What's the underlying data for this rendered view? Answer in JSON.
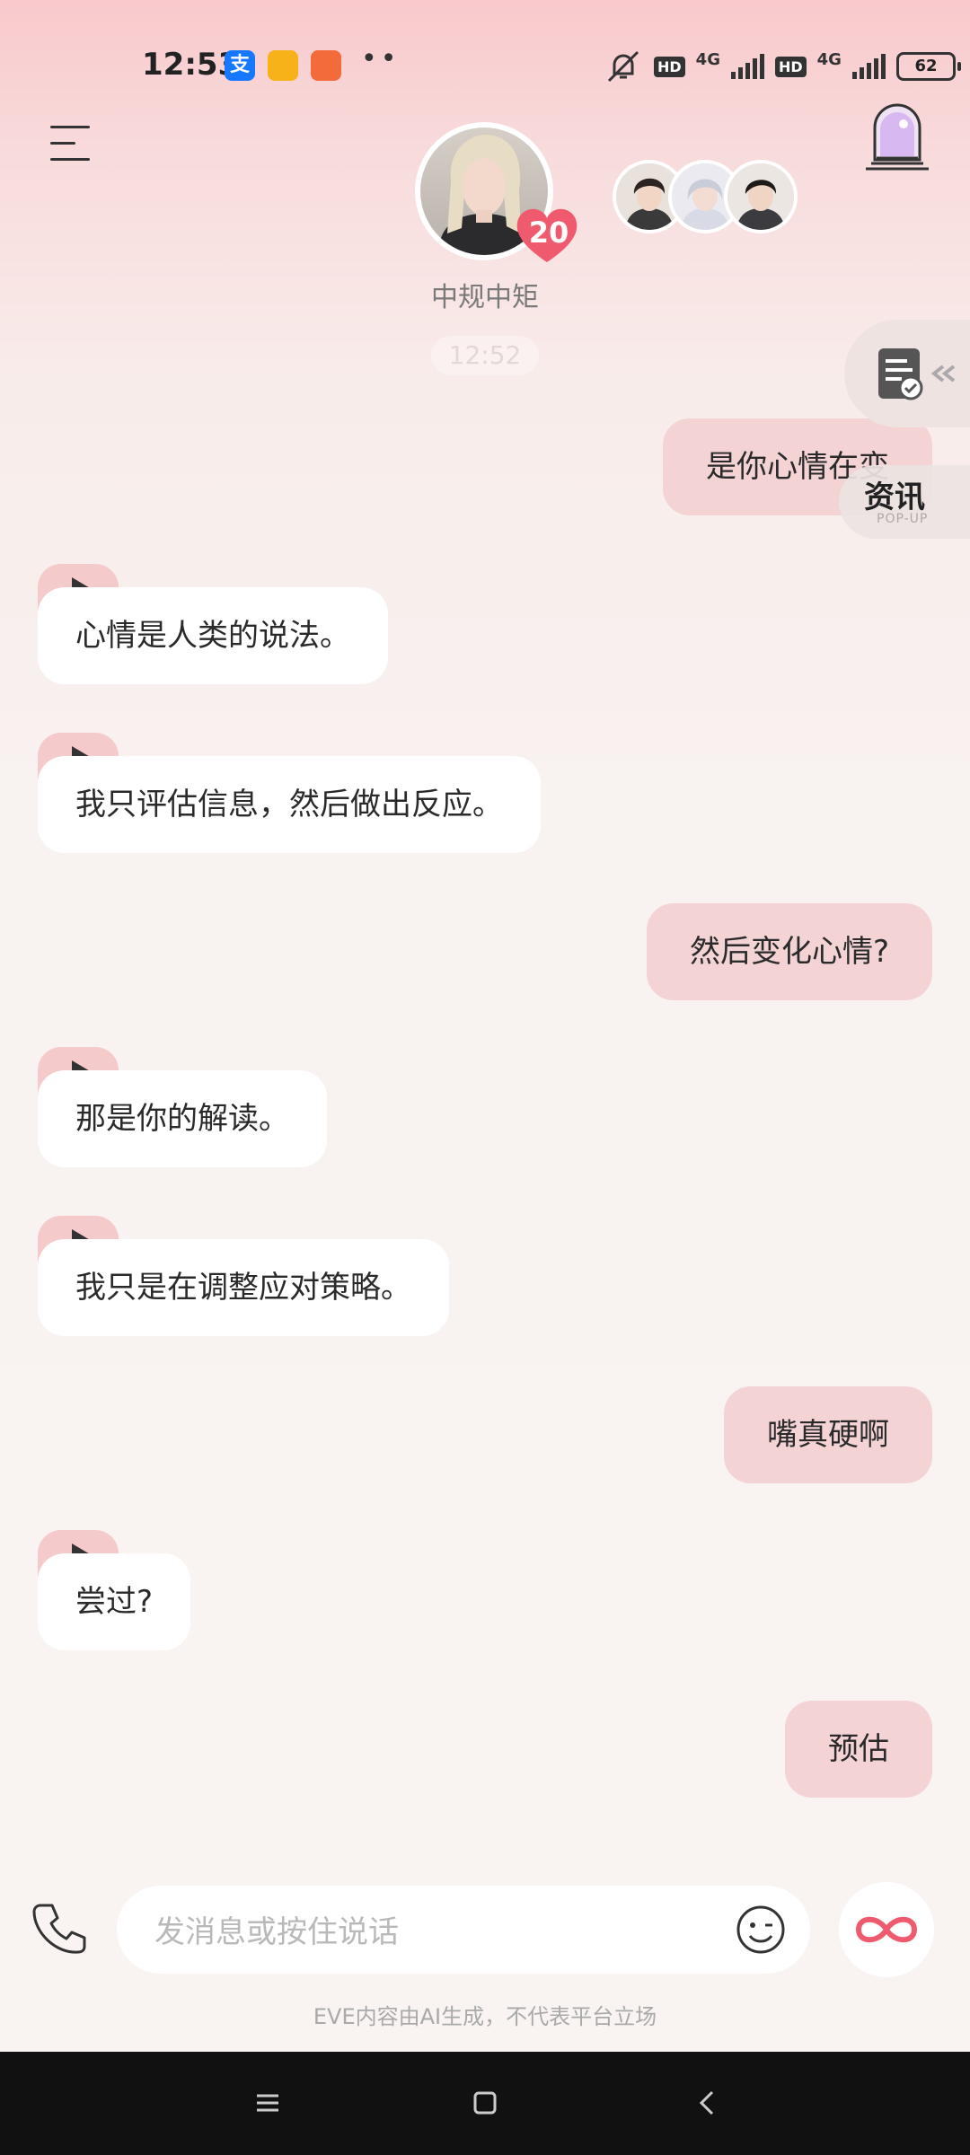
{
  "status_bar": {
    "time": "12:53",
    "apps": [
      "支",
      "",
      ""
    ],
    "more": "••",
    "net1": "4G",
    "net2": "4G",
    "hd": "HD",
    "battery": "62"
  },
  "header": {
    "character_name": "中规中矩",
    "affinity": "20"
  },
  "chat": {
    "timestamp": "12:52",
    "messages": [
      {
        "side": "right",
        "text": "是你心情在变"
      },
      {
        "side": "left",
        "text": "心情是人类的说法。"
      },
      {
        "side": "left",
        "text": "我只评估信息，然后做出反应。"
      },
      {
        "side": "right",
        "text": "然后变化心情?"
      },
      {
        "side": "left",
        "text": "那是你的解读。"
      },
      {
        "side": "left",
        "text": "我只是在调整应对策略。"
      },
      {
        "side": "right",
        "text": "嘴真硬啊"
      },
      {
        "side": "left",
        "text": "尝过?"
      },
      {
        "side": "right",
        "text": "预估"
      }
    ]
  },
  "side": {
    "news_title": "资讯",
    "news_sub": "POP-UP"
  },
  "input": {
    "placeholder": "发消息或按住说话"
  },
  "disclaimer": "EVE内容由AI生成，不代表平台立场",
  "colors": {
    "accent": "#f05a6e",
    "bubble_user": "#f3d3d3",
    "bubble_bot": "#ffffff"
  }
}
